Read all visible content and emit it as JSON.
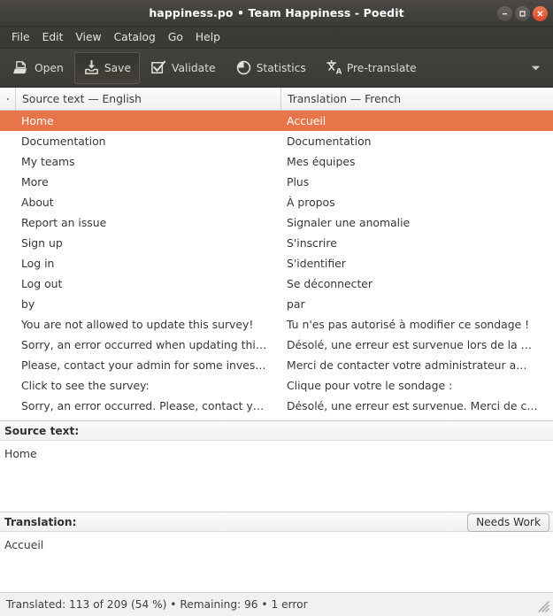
{
  "window": {
    "title": "happiness.po • Team Happiness - Poedit",
    "controls": [
      {
        "name": "minimize",
        "glyph": "−"
      },
      {
        "name": "maximize",
        "glyph": "□"
      },
      {
        "name": "close",
        "glyph": "×"
      }
    ]
  },
  "menubar": {
    "items": [
      "File",
      "Edit",
      "View",
      "Catalog",
      "Go",
      "Help"
    ]
  },
  "toolbar": {
    "buttons": [
      {
        "label": "Open",
        "icon": "open-folder-icon",
        "active": false
      },
      {
        "label": "Save",
        "icon": "save-icon",
        "active": true
      },
      {
        "label": "Validate",
        "icon": "validate-check-icon",
        "active": false
      },
      {
        "label": "Statistics",
        "icon": "statistics-pie-icon",
        "active": false
      },
      {
        "label": "Pre-translate",
        "icon": "pre-translate-icon",
        "active": false
      }
    ],
    "overflow_icon": "chevron-down-icon"
  },
  "list": {
    "headers": {
      "marker": "",
      "source": "Source text — English",
      "translation": "Translation — French"
    },
    "rows": [
      {
        "source": "Home",
        "translation": "Accueil",
        "selected": true
      },
      {
        "source": "Documentation",
        "translation": "Documentation",
        "selected": false
      },
      {
        "source": "My teams",
        "translation": "Mes équipes",
        "selected": false
      },
      {
        "source": "More",
        "translation": "Plus",
        "selected": false
      },
      {
        "source": "About",
        "translation": "À propos",
        "selected": false
      },
      {
        "source": "Report an issue",
        "translation": "Signaler une anomalie",
        "selected": false
      },
      {
        "source": "Sign up",
        "translation": "S'inscrire",
        "selected": false
      },
      {
        "source": "Log in",
        "translation": "S'identifier",
        "selected": false
      },
      {
        "source": "Log out",
        "translation": "Se déconnecter",
        "selected": false
      },
      {
        "source": "by",
        "translation": "par",
        "selected": false
      },
      {
        "source": "You are not allowed to update this survey!",
        "translation": "Tu n'es pas autorisé à modifier ce sondage !",
        "selected": false
      },
      {
        "source": "Sorry, an error occurred when updating thi…",
        "translation": "Désolé, une erreur est survenue lors de la …",
        "selected": false
      },
      {
        "source": "Please, contact your admin for some inves…",
        "translation": "Merci de contacter votre administrateur a…",
        "selected": false
      },
      {
        "source": "Click to see the survey:",
        "translation": "Clique pour votre le sondage :",
        "selected": false
      },
      {
        "source": "Sorry, an error occurred. Please, contact y…",
        "translation": "Désolé, une erreur est survenue. Merci de c…",
        "selected": false
      }
    ]
  },
  "source_pane": {
    "label": "Source text:",
    "value": "Home"
  },
  "translation_pane": {
    "label": "Translation:",
    "needs_work_label": "Needs Work",
    "value": "Accueil"
  },
  "statusbar": {
    "text": "Translated: 113 of 209 (54 %) • Remaining: 96 • 1 error",
    "grip_icon": "resize-grip-icon"
  },
  "colors": {
    "selection": "#e8744a",
    "titlebar": "#3c3b37",
    "close_button": "#d9442a"
  }
}
